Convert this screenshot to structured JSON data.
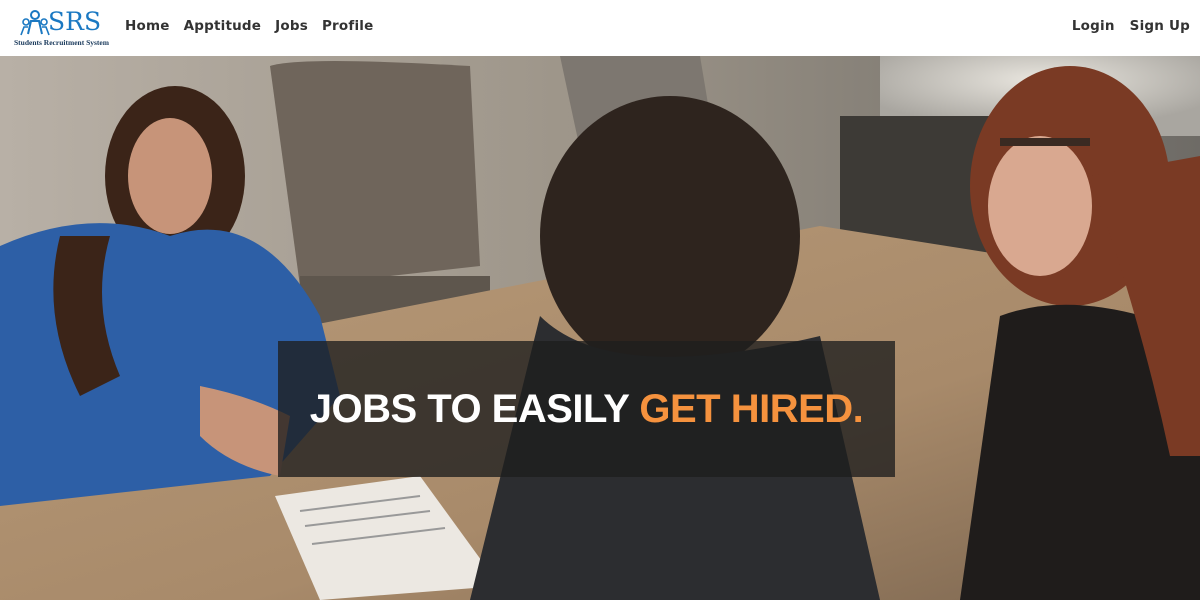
{
  "brand": {
    "name": "SRS",
    "subtitle": "Students Recruitment System"
  },
  "nav": {
    "left": [
      {
        "label": "Home"
      },
      {
        "label": "Apptitude"
      },
      {
        "label": "Jobs"
      },
      {
        "label": "Profile"
      }
    ],
    "right": [
      {
        "label": "Login"
      },
      {
        "label": "Sign Up"
      }
    ]
  },
  "hero": {
    "title_main": "JOBS TO EASILY ",
    "title_highlight": "GET HIRED.",
    "image_subject": "job-interview-photo"
  },
  "colors": {
    "brand_blue": "#1a78c2",
    "highlight_orange": "#f5923e",
    "banner_bg": "rgba(30,30,30,0.78)",
    "nav_text": "#333333"
  },
  "icons": {
    "logo": "people-group-icon"
  }
}
